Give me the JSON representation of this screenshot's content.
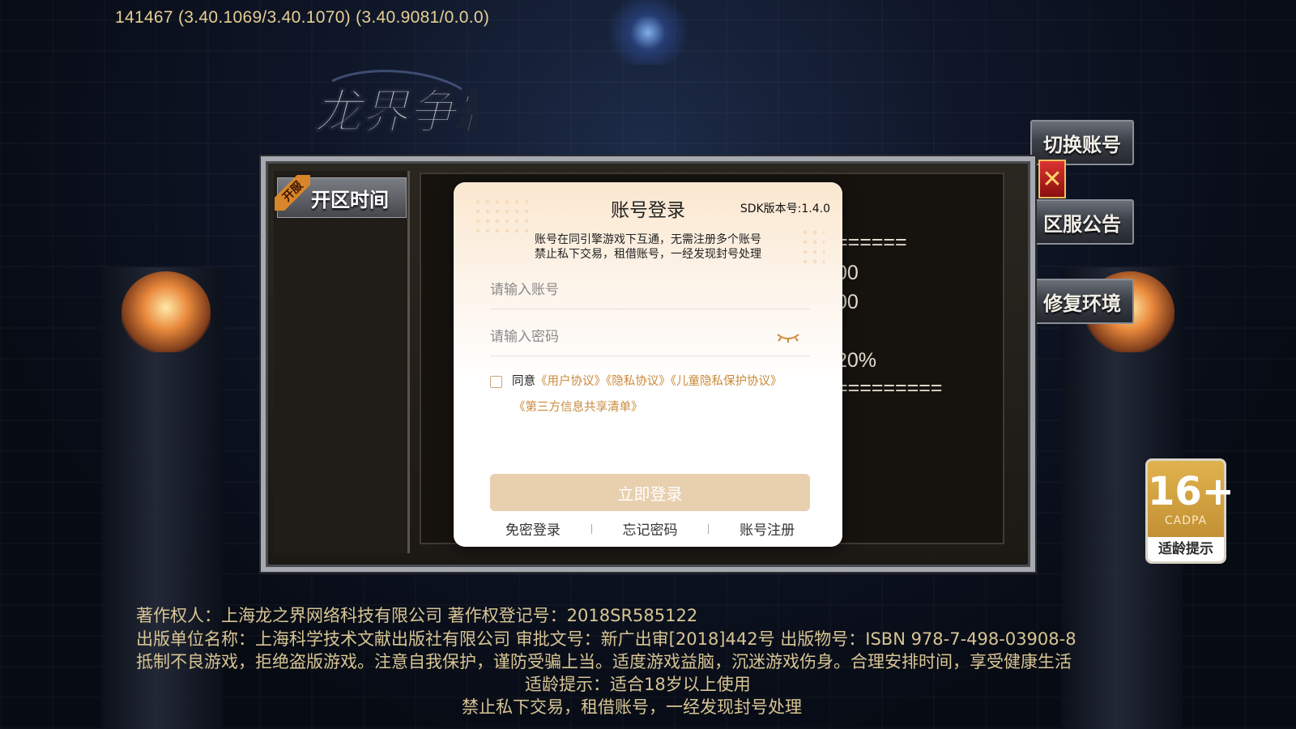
{
  "version_text": "141467 (3.40.1069/3.40.1070) (3.40.9081/0.0.0)",
  "logo_text": "龙界争霸",
  "side_buttons": {
    "switch_account": "切换账号",
    "server_notice": "区服公告",
    "repair_env": "修复环境"
  },
  "panel": {
    "tab_label": "开区时间",
    "ribbon": "开服",
    "bg_lines": [
      "======",
      "00",
      "00",
      "20%",
      "========="
    ]
  },
  "age_badge": {
    "number": "16+",
    "org": "CADPA",
    "tip": "适龄提示"
  },
  "dialog": {
    "title": "账号登录",
    "sdk_version": "SDK版本号:1.4.0",
    "notice_line1": "账号在同引擎游戏下互通，无需注册多个账号",
    "notice_line2": "禁止私下交易，租借账号，一经发现封号处理",
    "account_placeholder": "请输入账号",
    "password_placeholder": "请输入密码",
    "agree_prefix": "同意",
    "links": [
      "《用户协议》",
      "《隐私协议》",
      "《儿童隐私保护协议》",
      "《第三方信息共享清单》"
    ],
    "login_button": "立即登录",
    "bottom_links": [
      "免密登录",
      "忘记密码",
      "账号注册"
    ]
  },
  "footer": {
    "line1": "著作权人：上海龙之界网络科技有限公司  著作权登记号：2018SR585122",
    "line2": "出版单位名称：上海科学技术文献出版社有限公司    审批文号：新广出审[2018]442号      出版物号：ISBN 978-7-498-03908-8",
    "line3": "抵制不良游戏，拒绝盗版游戏。注意自我保护，谨防受骗上当。适度游戏益脑，沉迷游戏伤身。合理安排时间，享受健康生活",
    "line4": "适龄提示：适合18岁以上使用",
    "line5": "禁止私下交易，租借账号，一经发现封号处理"
  }
}
